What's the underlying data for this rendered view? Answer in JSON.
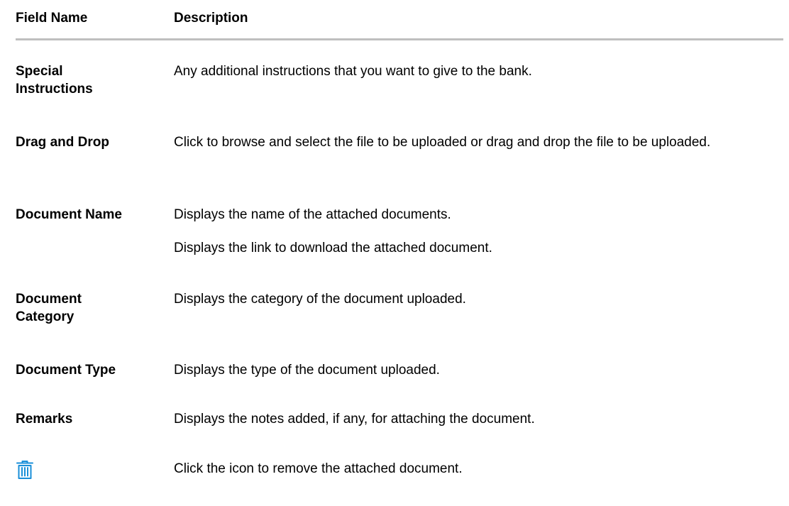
{
  "header": {
    "field_name": "Field Name",
    "description": "Description"
  },
  "rows": [
    {
      "name": "Special Instructions",
      "description": "Any additional instructions that you want to give to the bank."
    },
    {
      "name": "Drag and Drop",
      "description": "Click to browse and select the file to be uploaded or drag and drop the file to be uploaded."
    },
    {
      "name": "Document Name",
      "description": "Displays the name of the attached documents."
    },
    {
      "name": "",
      "description": "Displays the link to download the attached document."
    },
    {
      "name": "Document Category",
      "description": "Displays the category of the document uploaded."
    },
    {
      "name": "Document Type",
      "description": "Displays the type of the document uploaded."
    },
    {
      "name": "Remarks",
      "description": "Displays the notes added, if any, for attaching the document."
    },
    {
      "icon": "trash-icon",
      "description": "Click the icon to remove the attached document."
    }
  ],
  "colors": {
    "rule": "#bfbfbf",
    "icon": "#1a8fd8"
  }
}
